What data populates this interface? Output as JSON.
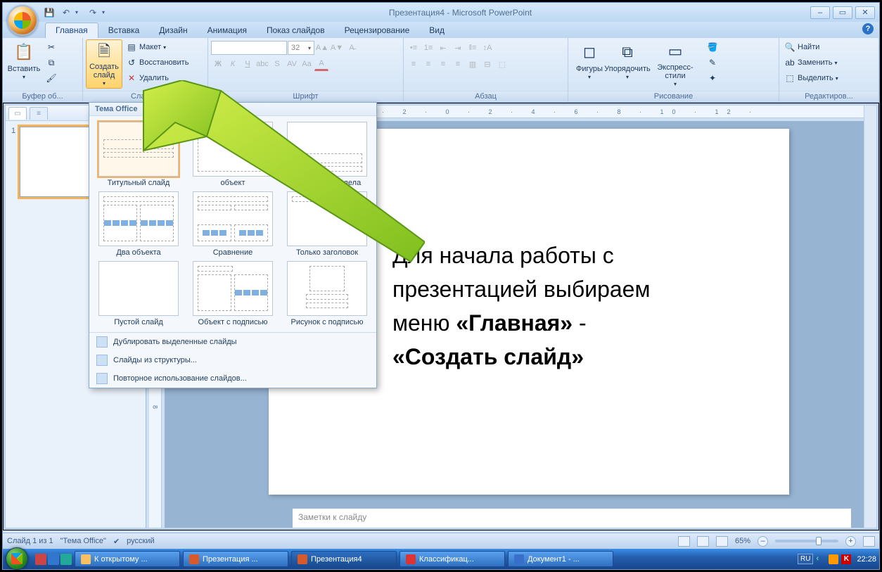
{
  "titlebar": {
    "title": "Презентация4 - Microsoft PowerPoint"
  },
  "tabs": {
    "items": [
      "Главная",
      "Вставка",
      "Дизайн",
      "Анимация",
      "Показ слайдов",
      "Рецензирование",
      "Вид"
    ],
    "active": 0
  },
  "ribbon": {
    "clipboard": {
      "paste": "Вставить",
      "label": "Буфер об..."
    },
    "slides": {
      "new_slide": "Создать слайд",
      "layout": "Макет",
      "reset": "Восстановить",
      "delete": "Удалить",
      "label": "Слайды"
    },
    "font": {
      "name_placeholder": "",
      "size_value": "32",
      "label": "Шрифт"
    },
    "paragraph": {
      "label": "Абзац"
    },
    "drawing": {
      "shapes": "Фигуры",
      "arrange": "Упорядочить",
      "quickstyles": "Экспресс-стили",
      "label": "Рисование"
    },
    "editing": {
      "find": "Найти",
      "replace": "Заменить",
      "select": "Выделить",
      "label": "Редактиров..."
    }
  },
  "gallery": {
    "header": "Тема Office",
    "layouts": [
      "Титульный слайд",
      "объект",
      "Заголовок раздела",
      "Два объекта",
      "Сравнение",
      "Только заголовок",
      "Пустой слайд",
      "Объект с подписью",
      "Рисунок с подписью"
    ],
    "menu": [
      "Дублировать выделенные слайды",
      "Слайды из структуры...",
      "Повторное использование слайдов..."
    ]
  },
  "side": {
    "slide_num": "1"
  },
  "overlay": {
    "line1": "Для начала работы с",
    "line2": "презентацией выбираем",
    "line3_a": "меню ",
    "line3_b": "«Главная»",
    "line3_c": " -",
    "line4": "«Создать слайд»"
  },
  "notes": {
    "placeholder": "Заметки к слайду"
  },
  "status": {
    "slide_info": "Слайд 1 из 1",
    "theme": "\"Тема Office\"",
    "language": "русский",
    "zoom": "65%"
  },
  "taskbar": {
    "items": [
      {
        "label": "К открытому ..."
      },
      {
        "label": "Презентация ..."
      },
      {
        "label": "Презентация4",
        "active": true
      },
      {
        "label": "Классификац..."
      },
      {
        "label": "Документ1 - ..."
      }
    ],
    "lang": "RU",
    "time": "22:28"
  }
}
